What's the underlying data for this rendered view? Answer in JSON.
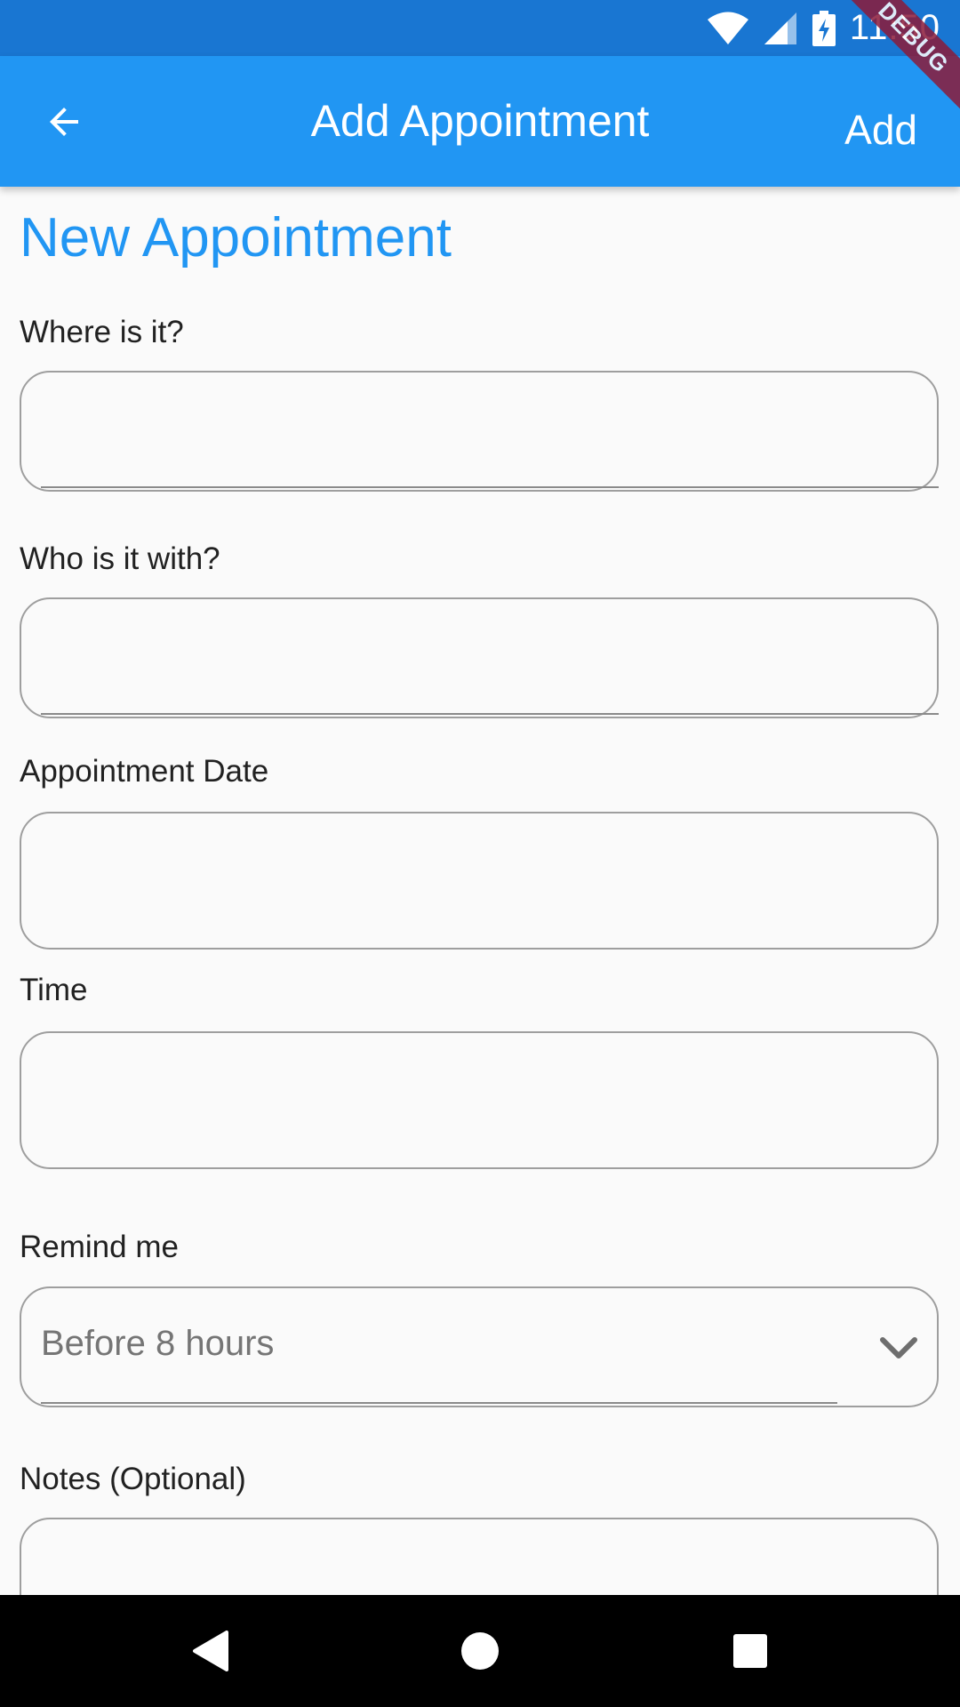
{
  "status_bar": {
    "time": "11:50",
    "icons": [
      "wifi-icon",
      "cell-signal-icon",
      "battery-charging-icon"
    ]
  },
  "debug_banner": {
    "label": "DEBUG"
  },
  "app_bar": {
    "title": "Add Appointment",
    "back_icon": "arrow-back-icon",
    "action_label": "Add"
  },
  "form": {
    "heading": "New Appointment",
    "fields": {
      "location": {
        "label": "Where is it?",
        "value": ""
      },
      "with": {
        "label": "Who is it with?",
        "value": ""
      },
      "date": {
        "label": "Appointment Date",
        "value": ""
      },
      "time": {
        "label": "Time",
        "value": ""
      },
      "remind": {
        "label": "Remind me",
        "value": "Before  8 hours",
        "icon": "chevron-down-icon"
      },
      "notes": {
        "label": "Notes (Optional)",
        "value": ""
      }
    }
  },
  "nav_bar": {
    "buttons": [
      "back-triangle-icon",
      "home-circle-icon",
      "recents-square-icon"
    ]
  },
  "colors": {
    "status_bar": "#1976d2",
    "app_bar": "#2196f3",
    "heading": "#2196f3",
    "background": "#fafafa",
    "field_border": "#9e9e9e",
    "debug_banner": "#8b1b3a"
  }
}
